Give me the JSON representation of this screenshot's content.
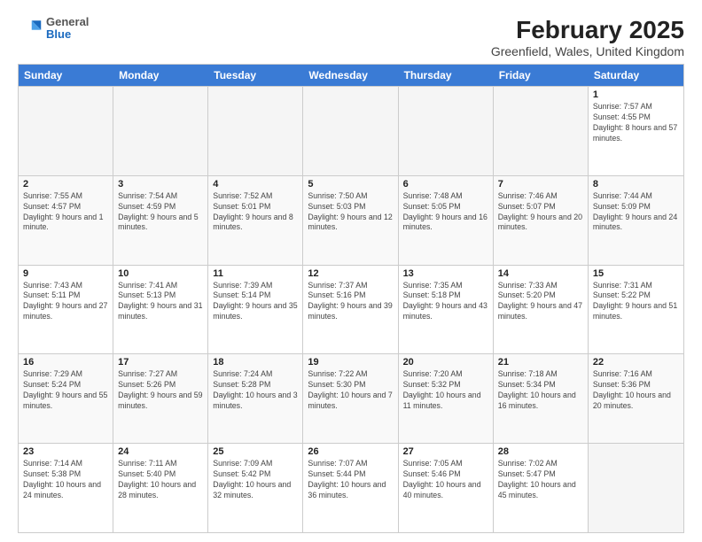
{
  "header": {
    "logo": {
      "general": "General",
      "blue": "Blue"
    },
    "title": "February 2025",
    "subtitle": "Greenfield, Wales, United Kingdom"
  },
  "weekdays": [
    "Sunday",
    "Monday",
    "Tuesday",
    "Wednesday",
    "Thursday",
    "Friday",
    "Saturday"
  ],
  "rows": [
    [
      {
        "day": "",
        "info": "",
        "empty": true
      },
      {
        "day": "",
        "info": "",
        "empty": true
      },
      {
        "day": "",
        "info": "",
        "empty": true
      },
      {
        "day": "",
        "info": "",
        "empty": true
      },
      {
        "day": "",
        "info": "",
        "empty": true
      },
      {
        "day": "",
        "info": "",
        "empty": true
      },
      {
        "day": "1",
        "info": "Sunrise: 7:57 AM\nSunset: 4:55 PM\nDaylight: 8 hours\nand 57 minutes.",
        "empty": false
      }
    ],
    [
      {
        "day": "2",
        "info": "Sunrise: 7:55 AM\nSunset: 4:57 PM\nDaylight: 9 hours\nand 1 minute.",
        "empty": false
      },
      {
        "day": "3",
        "info": "Sunrise: 7:54 AM\nSunset: 4:59 PM\nDaylight: 9 hours\nand 5 minutes.",
        "empty": false
      },
      {
        "day": "4",
        "info": "Sunrise: 7:52 AM\nSunset: 5:01 PM\nDaylight: 9 hours\nand 8 minutes.",
        "empty": false
      },
      {
        "day": "5",
        "info": "Sunrise: 7:50 AM\nSunset: 5:03 PM\nDaylight: 9 hours\nand 12 minutes.",
        "empty": false
      },
      {
        "day": "6",
        "info": "Sunrise: 7:48 AM\nSunset: 5:05 PM\nDaylight: 9 hours\nand 16 minutes.",
        "empty": false
      },
      {
        "day": "7",
        "info": "Sunrise: 7:46 AM\nSunset: 5:07 PM\nDaylight: 9 hours\nand 20 minutes.",
        "empty": false
      },
      {
        "day": "8",
        "info": "Sunrise: 7:44 AM\nSunset: 5:09 PM\nDaylight: 9 hours\nand 24 minutes.",
        "empty": false
      }
    ],
    [
      {
        "day": "9",
        "info": "Sunrise: 7:43 AM\nSunset: 5:11 PM\nDaylight: 9 hours\nand 27 minutes.",
        "empty": false
      },
      {
        "day": "10",
        "info": "Sunrise: 7:41 AM\nSunset: 5:13 PM\nDaylight: 9 hours\nand 31 minutes.",
        "empty": false
      },
      {
        "day": "11",
        "info": "Sunrise: 7:39 AM\nSunset: 5:14 PM\nDaylight: 9 hours\nand 35 minutes.",
        "empty": false
      },
      {
        "day": "12",
        "info": "Sunrise: 7:37 AM\nSunset: 5:16 PM\nDaylight: 9 hours\nand 39 minutes.",
        "empty": false
      },
      {
        "day": "13",
        "info": "Sunrise: 7:35 AM\nSunset: 5:18 PM\nDaylight: 9 hours\nand 43 minutes.",
        "empty": false
      },
      {
        "day": "14",
        "info": "Sunrise: 7:33 AM\nSunset: 5:20 PM\nDaylight: 9 hours\nand 47 minutes.",
        "empty": false
      },
      {
        "day": "15",
        "info": "Sunrise: 7:31 AM\nSunset: 5:22 PM\nDaylight: 9 hours\nand 51 minutes.",
        "empty": false
      }
    ],
    [
      {
        "day": "16",
        "info": "Sunrise: 7:29 AM\nSunset: 5:24 PM\nDaylight: 9 hours\nand 55 minutes.",
        "empty": false
      },
      {
        "day": "17",
        "info": "Sunrise: 7:27 AM\nSunset: 5:26 PM\nDaylight: 9 hours\nand 59 minutes.",
        "empty": false
      },
      {
        "day": "18",
        "info": "Sunrise: 7:24 AM\nSunset: 5:28 PM\nDaylight: 10 hours\nand 3 minutes.",
        "empty": false
      },
      {
        "day": "19",
        "info": "Sunrise: 7:22 AM\nSunset: 5:30 PM\nDaylight: 10 hours\nand 7 minutes.",
        "empty": false
      },
      {
        "day": "20",
        "info": "Sunrise: 7:20 AM\nSunset: 5:32 PM\nDaylight: 10 hours\nand 11 minutes.",
        "empty": false
      },
      {
        "day": "21",
        "info": "Sunrise: 7:18 AM\nSunset: 5:34 PM\nDaylight: 10 hours\nand 16 minutes.",
        "empty": false
      },
      {
        "day": "22",
        "info": "Sunrise: 7:16 AM\nSunset: 5:36 PM\nDaylight: 10 hours\nand 20 minutes.",
        "empty": false
      }
    ],
    [
      {
        "day": "23",
        "info": "Sunrise: 7:14 AM\nSunset: 5:38 PM\nDaylight: 10 hours\nand 24 minutes.",
        "empty": false
      },
      {
        "day": "24",
        "info": "Sunrise: 7:11 AM\nSunset: 5:40 PM\nDaylight: 10 hours\nand 28 minutes.",
        "empty": false
      },
      {
        "day": "25",
        "info": "Sunrise: 7:09 AM\nSunset: 5:42 PM\nDaylight: 10 hours\nand 32 minutes.",
        "empty": false
      },
      {
        "day": "26",
        "info": "Sunrise: 7:07 AM\nSunset: 5:44 PM\nDaylight: 10 hours\nand 36 minutes.",
        "empty": false
      },
      {
        "day": "27",
        "info": "Sunrise: 7:05 AM\nSunset: 5:46 PM\nDaylight: 10 hours\nand 40 minutes.",
        "empty": false
      },
      {
        "day": "28",
        "info": "Sunrise: 7:02 AM\nSunset: 5:47 PM\nDaylight: 10 hours\nand 45 minutes.",
        "empty": false
      },
      {
        "day": "",
        "info": "",
        "empty": true
      }
    ]
  ]
}
